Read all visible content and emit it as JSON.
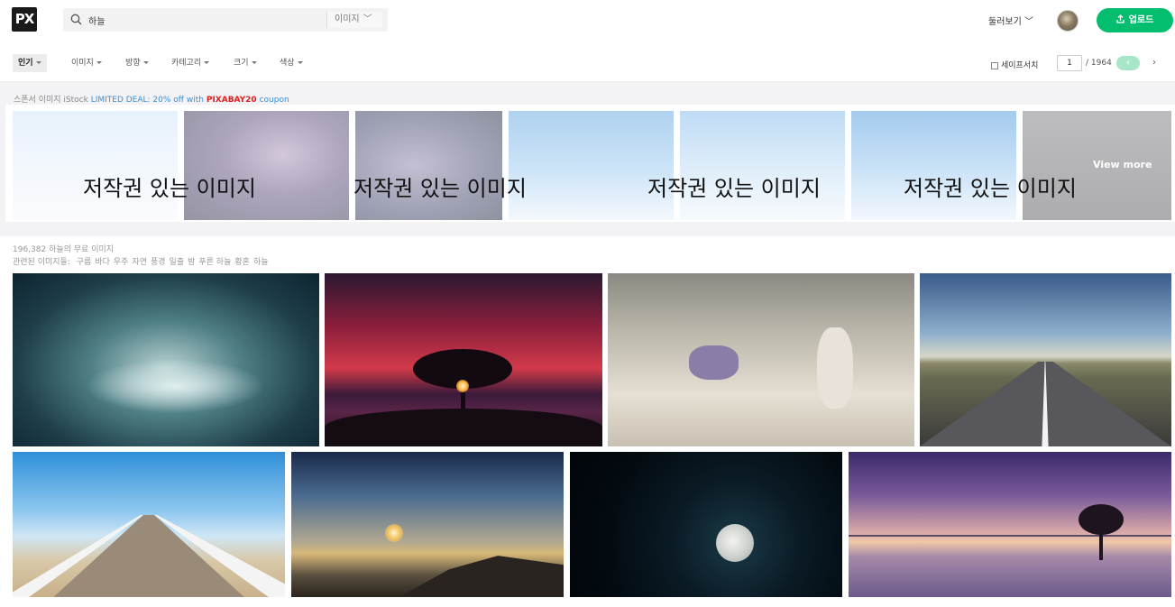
{
  "header": {
    "logo": "PX",
    "search_value": "하늘",
    "search_type": "이미지",
    "explore": "둘러보기",
    "upload": "업로드"
  },
  "filters": {
    "sort": "인기",
    "items": [
      "이미지",
      "방향",
      "카테고리",
      "크기",
      "색상"
    ],
    "safesearch": "세이프서치",
    "page": "1",
    "total_pages": "/ 1964",
    "prev": "‹",
    "next": "›"
  },
  "sponsor": {
    "label": "스폰서 이미지 iStock",
    "deal": "LIMITED DEAL: 20% off with",
    "code": "PIXABAY20",
    "suffix": "coupon",
    "watermark": "저작권 있는 이미지",
    "more": "View more"
  },
  "results": {
    "count": "196,382 하늘의 무료 이미지",
    "related_label": "관련된 이미지들:",
    "related": [
      "구름",
      "바다",
      "우주",
      "자연",
      "풍경",
      "일출",
      "밤",
      "푸른 하늘",
      "황혼",
      "하늘"
    ]
  },
  "colors": {
    "accent": "#02be6e",
    "deal": "#3a8fd8",
    "code": "#e02020"
  }
}
